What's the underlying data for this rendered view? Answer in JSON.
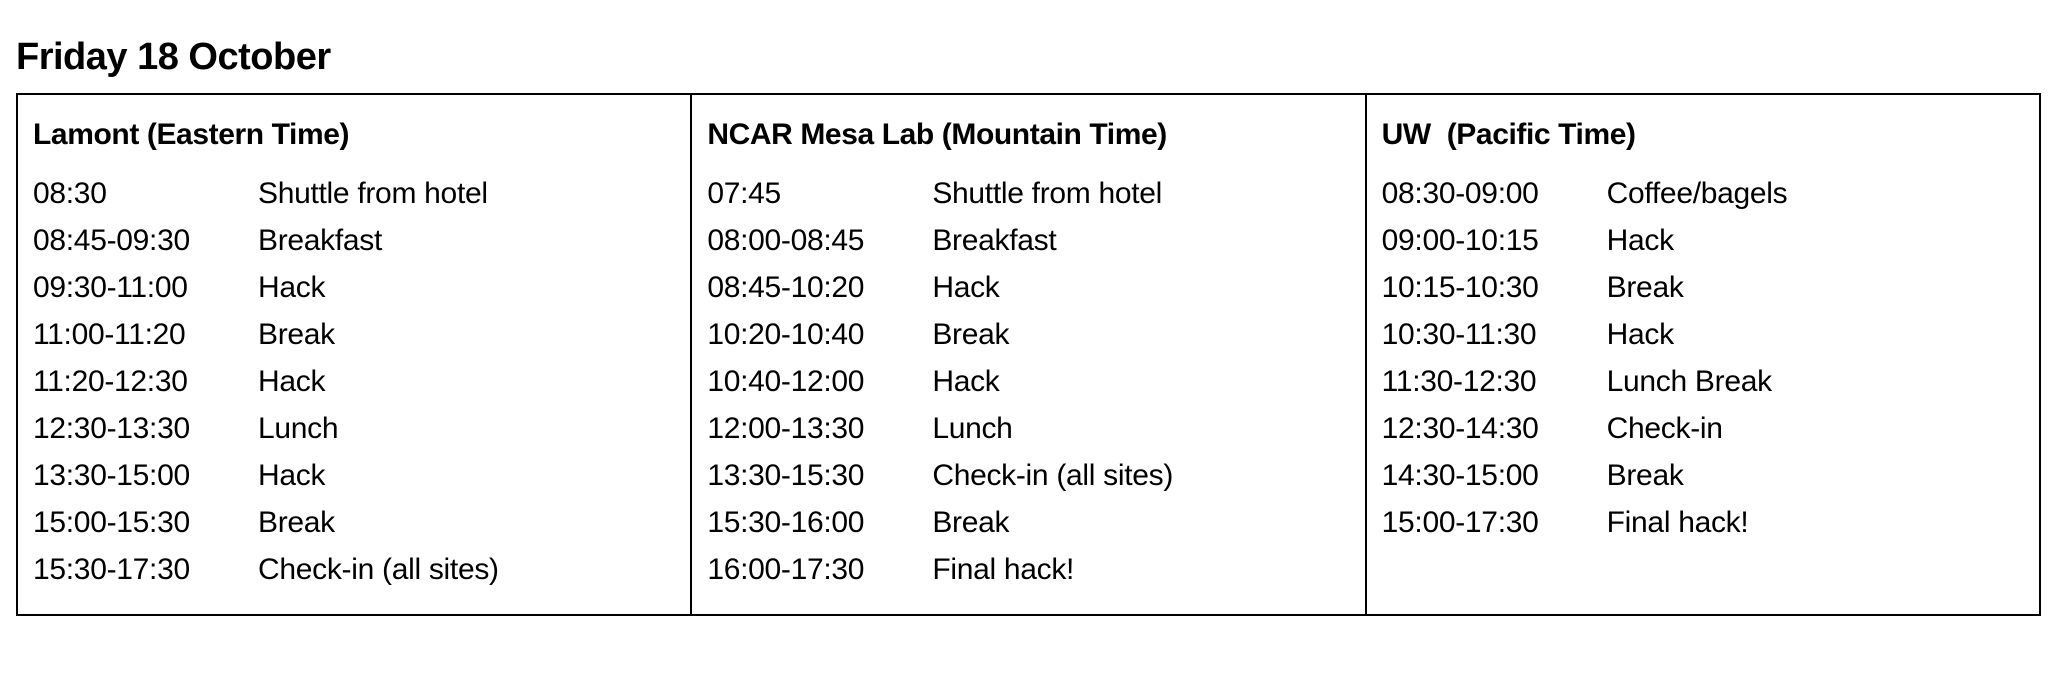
{
  "title": "Friday 18 October",
  "sites": [
    {
      "heading": "Lamont (Eastern Time)",
      "rows": [
        {
          "time": "08:30",
          "activity": "Shuttle from hotel"
        },
        {
          "time": "08:45-09:30",
          "activity": "Breakfast"
        },
        {
          "time": "09:30-11:00",
          "activity": "Hack"
        },
        {
          "time": "11:00-11:20",
          "activity": "Break"
        },
        {
          "time": "11:20-12:30",
          "activity": "Hack"
        },
        {
          "time": "12:30-13:30",
          "activity": "Lunch"
        },
        {
          "time": "13:30-15:00",
          "activity": "Hack"
        },
        {
          "time": "15:00-15:30",
          "activity": "Break"
        },
        {
          "time": "15:30-17:30",
          "activity": "Check-in (all sites)"
        }
      ]
    },
    {
      "heading": "NCAR Mesa Lab (Mountain Time)",
      "rows": [
        {
          "time": "07:45",
          "activity": "Shuttle from hotel"
        },
        {
          "time": "08:00-08:45",
          "activity": "Breakfast"
        },
        {
          "time": "08:45-10:20",
          "activity": "Hack"
        },
        {
          "time": "10:20-10:40",
          "activity": "Break"
        },
        {
          "time": "10:40-12:00",
          "activity": "Hack"
        },
        {
          "time": "12:00-13:30",
          "activity": "Lunch"
        },
        {
          "time": "13:30-15:30",
          "activity": "Check-in (all sites)"
        },
        {
          "time": "15:30-16:00",
          "activity": "Break"
        },
        {
          "time": "16:00-17:30",
          "activity": "Final hack!"
        }
      ]
    },
    {
      "heading": "UW  (Pacific Time)",
      "rows": [
        {
          "time": "08:30-09:00",
          "activity": "Coffee/bagels"
        },
        {
          "time": "09:00-10:15",
          "activity": "Hack"
        },
        {
          "time": "10:15-10:30",
          "activity": "Break"
        },
        {
          "time": "10:30-11:30",
          "activity": "Hack"
        },
        {
          "time": "11:30-12:30",
          "activity": "Lunch Break"
        },
        {
          "time": "12:30-14:30",
          "activity": "Check-in"
        },
        {
          "time": "14:30-15:00",
          "activity": "Break"
        },
        {
          "time": "15:00-17:30",
          "activity": "Final hack!"
        }
      ]
    }
  ]
}
